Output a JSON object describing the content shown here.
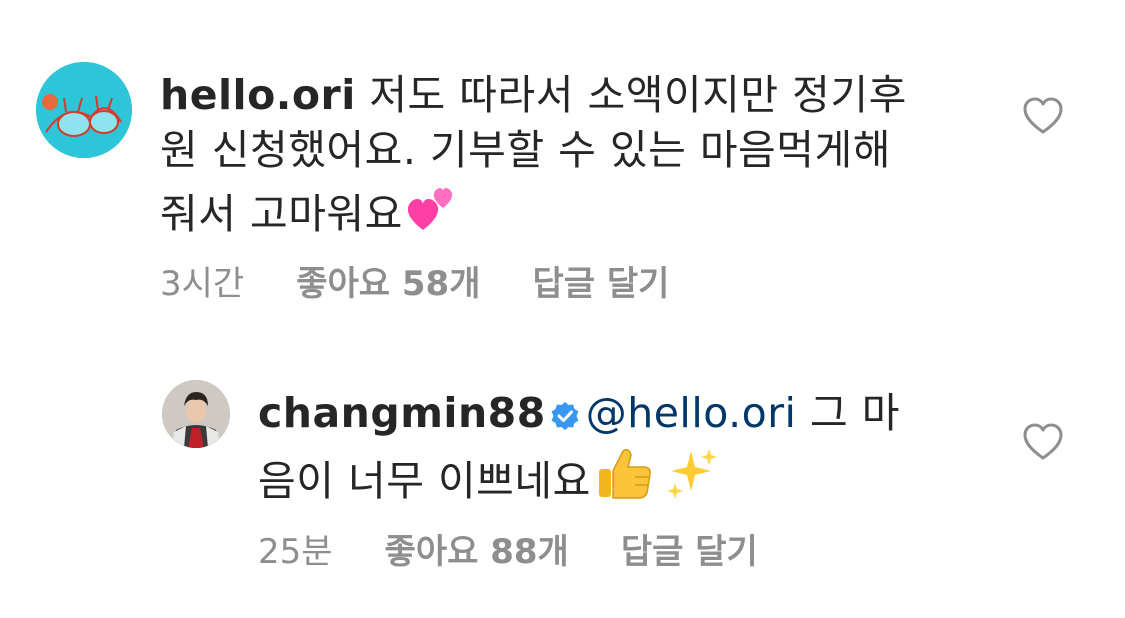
{
  "comments": [
    {
      "username": "hello.ori",
      "verified": false,
      "mention": "",
      "text": "저도 따라서 소액이지만 정기후원 신청했어요. 기부할 수 있는 마음먹게해줘서 고마워요",
      "line1": " 저도 따라서 소액이지만 정기후",
      "line2": "원 신청했어요. 기부할 수 있는 마음먹게해",
      "line3": "줘서 고마워요",
      "emoji": "two-hearts",
      "time": "3시간",
      "likes": "좋아요 58개",
      "reply": "답글 달기"
    },
    {
      "username": "changmin88",
      "verified": true,
      "mention": "@hello.ori",
      "line1": " 그 마",
      "line2": "음이 너무 이쁘네요",
      "emoji": [
        "thumbs-up",
        "sparkles"
      ],
      "time": "25분",
      "likes": "좋아요 88개",
      "reply": "답글 달기"
    }
  ],
  "icons": {
    "like": "heart-outline-icon",
    "verified": "verified-badge-icon"
  },
  "colors": {
    "text": "#262626",
    "meta": "#8e8e8e",
    "mention": "#00376b",
    "verified": "#3897f0",
    "heart_stroke": "#8e8e8e"
  }
}
